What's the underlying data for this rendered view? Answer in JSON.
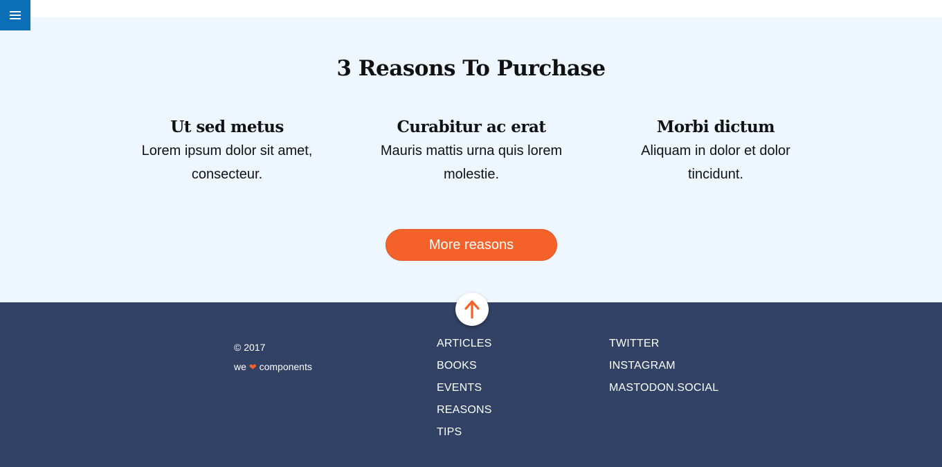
{
  "menu": {
    "icon": "hamburger-menu-icon"
  },
  "reasons": {
    "title": "3 Reasons To Purchase",
    "items": [
      {
        "heading": "Ut sed metus",
        "text": "Lorem ipsum dolor sit amet, consecteur."
      },
      {
        "heading": "Curabitur ac erat",
        "text": "Mauris mattis urna quis lorem molestie."
      },
      {
        "heading": "Morbi dictum",
        "text": "Aliquam in dolor et dolor tincidunt."
      }
    ],
    "more_button": "More reasons"
  },
  "footer": {
    "back_to_top_icon": "arrow-up-icon",
    "copyright": "© 2017",
    "tagline_before": "we",
    "tagline_heart": "❤",
    "tagline_after": "components",
    "nav_links": [
      "ARTICLES",
      "BOOKS",
      "EVENTS",
      "REASONS",
      "TIPS"
    ],
    "social_links": [
      "TWITTER",
      "INSTAGRAM",
      "MASTODON.SOCIAL"
    ]
  },
  "colors": {
    "menu_bg": "#0b6fb8",
    "section_bg": "#eef7ff",
    "accent": "#f4622a",
    "footer_bg": "#314265"
  }
}
